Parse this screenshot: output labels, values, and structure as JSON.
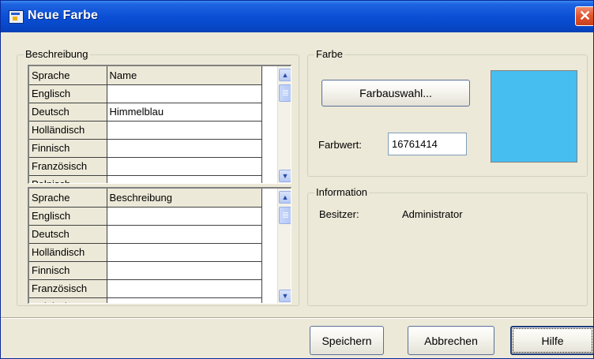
{
  "window": {
    "title": "Neue Farbe",
    "close_label": "✕"
  },
  "beschreibung": {
    "legend": "Beschreibung",
    "name_grid": {
      "headers": [
        "Sprache",
        "Name"
      ],
      "rows": [
        [
          "Englisch",
          ""
        ],
        [
          "Deutsch",
          "Himmelblau"
        ],
        [
          "Holländisch",
          ""
        ],
        [
          "Finnisch",
          ""
        ],
        [
          "Französisch",
          ""
        ],
        [
          "Polnisch",
          ""
        ]
      ]
    },
    "desc_grid": {
      "headers": [
        "Sprache",
        "Beschreibung"
      ],
      "rows": [
        [
          "Englisch",
          ""
        ],
        [
          "Deutsch",
          ""
        ],
        [
          "Holländisch",
          ""
        ],
        [
          "Finnisch",
          ""
        ],
        [
          "Französisch",
          ""
        ],
        [
          "Polnisch",
          ""
        ]
      ]
    }
  },
  "farbe": {
    "legend": "Farbe",
    "picker_label": "Farbauswahl...",
    "value_label": "Farbwert:",
    "value": "16761414",
    "swatch_color": "#46bef0"
  },
  "information": {
    "legend": "Information",
    "owner_label": "Besitzer:",
    "owner_value": "Administrator"
  },
  "buttons": {
    "save": "Speichern",
    "cancel": "Abbrechen",
    "help": "Hilfe"
  }
}
